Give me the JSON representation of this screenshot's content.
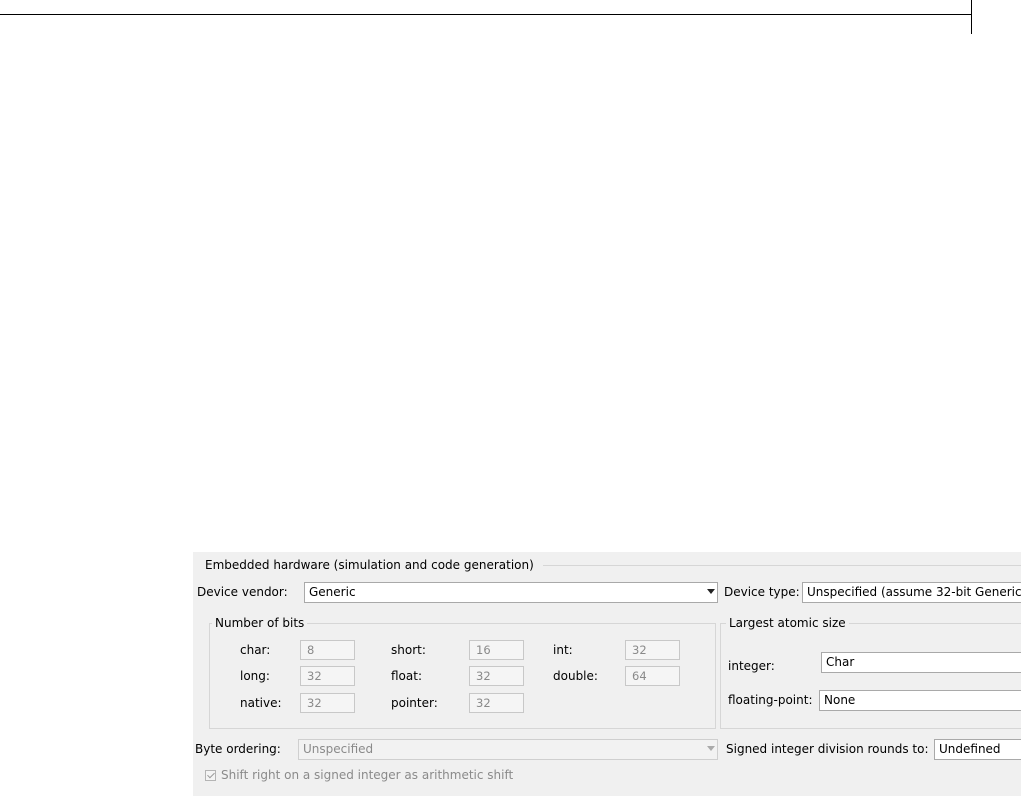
{
  "panel": {
    "title": "Embedded hardware (simulation and code generation)",
    "device_vendor": {
      "label": "Device vendor:",
      "value": "Generic"
    },
    "device_type": {
      "label": "Device type:",
      "value": "Unspecified (assume 32-bit Generic"
    },
    "number_of_bits": {
      "title": "Number of bits",
      "char": {
        "label": "char:",
        "value": "8"
      },
      "short": {
        "label": "short:",
        "value": "16"
      },
      "int": {
        "label": "int:",
        "value": "32"
      },
      "long": {
        "label": "long:",
        "value": "32"
      },
      "float": {
        "label": "float:",
        "value": "32"
      },
      "double": {
        "label": "double:",
        "value": "64"
      },
      "native": {
        "label": "native:",
        "value": "32"
      },
      "pointer": {
        "label": "pointer:",
        "value": "32"
      }
    },
    "largest_atomic_size": {
      "title": "Largest atomic size",
      "integer": {
        "label": "integer:",
        "value": "Char"
      },
      "floating_point": {
        "label": "floating-point:",
        "value": "None"
      }
    },
    "byte_ordering": {
      "label": "Byte ordering:",
      "value": "Unspecified"
    },
    "signed_division": {
      "label": "Signed integer division rounds to:",
      "value": "Undefined"
    },
    "shift_right": {
      "label": "Shift right on a signed integer as arithmetic shift",
      "checked": true
    }
  },
  "icons": {
    "dropdown": "chevron-down-icon",
    "check": "check-icon"
  }
}
